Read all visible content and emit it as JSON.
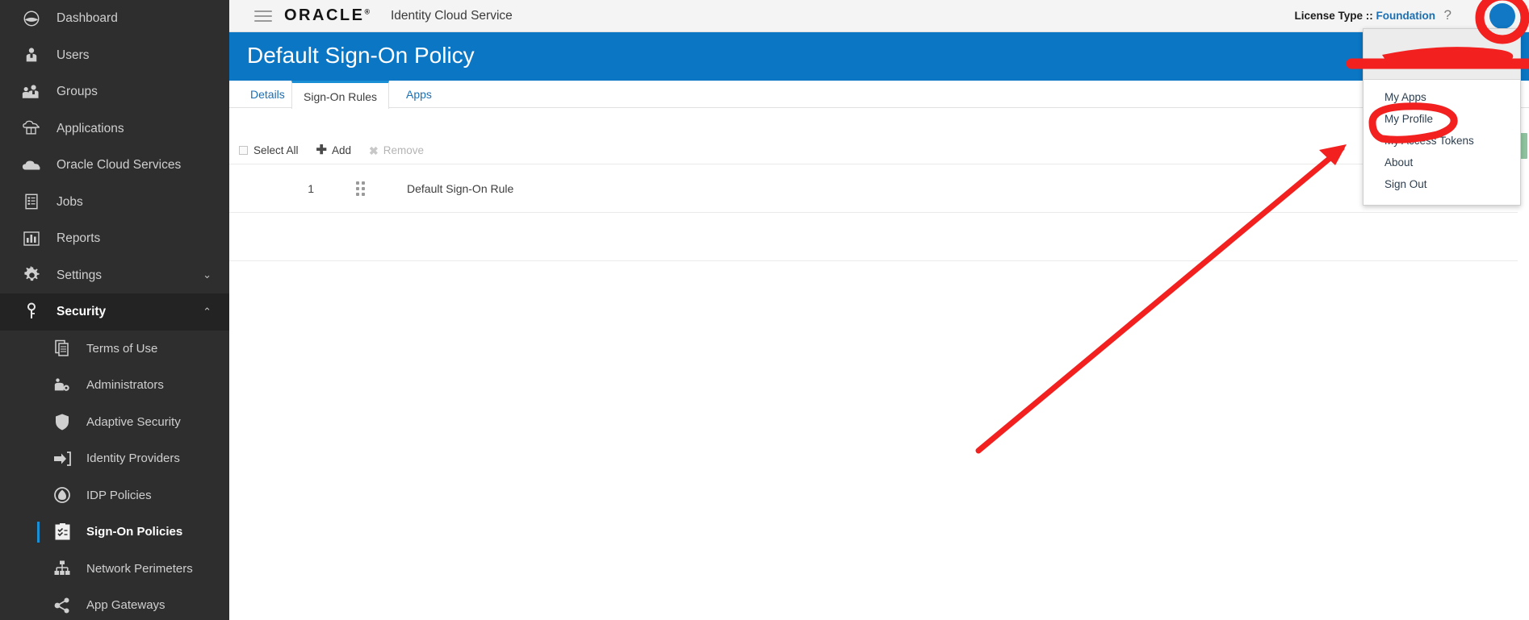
{
  "app": {
    "brand": "ORACLE",
    "brand_mark": "®",
    "name": "Identity Cloud Service",
    "hamburger_icon": "hamburger-menu-icon"
  },
  "topbar": {
    "license_label": "License Type ::",
    "license_value": "Foundation",
    "help_icon": "?",
    "avatar_icon": "user-avatar-icon",
    "avatar_color": "#1078c4"
  },
  "banner": {
    "title": "Default Sign-On Policy",
    "color": "#0a76c4"
  },
  "tabs": [
    {
      "label": "Details",
      "active": false
    },
    {
      "label": "Sign-On Rules",
      "active": true
    },
    {
      "label": "Apps",
      "active": false
    }
  ],
  "toolbar": {
    "select_all_label": "Select All",
    "add_label": "Add",
    "add_icon": "plus-icon",
    "remove_label": "Remove",
    "remove_icon": "close-x-icon",
    "remove_disabled": true
  },
  "table": {
    "rows": [
      {
        "number": "1",
        "handle_icon": "drag-handle-icon",
        "name": "Default Sign-On Rule"
      }
    ]
  },
  "scrollbar": {
    "thumb_color": "#8fc3a0"
  },
  "user_menu": {
    "username": "",
    "items": [
      {
        "label": "My Apps",
        "highlighted": false
      },
      {
        "label": "My Profile",
        "highlighted": true
      },
      {
        "label": "My Access Tokens",
        "highlighted": false
      },
      {
        "label": "About",
        "highlighted": false
      },
      {
        "label": "Sign Out",
        "highlighted": false
      }
    ]
  },
  "annotations": {
    "color": "#f32020",
    "shapes": [
      "circle-around-avatar",
      "redaction-scribble-over-username",
      "circle-around-my-profile",
      "arrow-pointing-to-my-profile"
    ]
  },
  "sidebar": {
    "background": "#2e2e2e",
    "items": [
      {
        "label": "Dashboard",
        "icon": "dashboard-icon",
        "level": 0,
        "chevron": "",
        "active": false
      },
      {
        "label": "Users",
        "icon": "user-icon",
        "level": 0,
        "chevron": "",
        "active": false
      },
      {
        "label": "Groups",
        "icon": "groups-icon",
        "level": 0,
        "chevron": "",
        "active": false
      },
      {
        "label": "Applications",
        "icon": "applications-icon",
        "level": 0,
        "chevron": "",
        "active": false
      },
      {
        "label": "Oracle Cloud Services",
        "icon": "cloud-icon",
        "level": 0,
        "chevron": "",
        "active": false
      },
      {
        "label": "Jobs",
        "icon": "jobs-clipboard-icon",
        "level": 0,
        "chevron": "",
        "active": false
      },
      {
        "label": "Reports",
        "icon": "reports-bar-chart-icon",
        "level": 0,
        "chevron": "",
        "active": false
      },
      {
        "label": "Settings",
        "icon": "gear-icon",
        "level": 0,
        "chevron": "chevron-down-icon",
        "active": false
      },
      {
        "label": "Security",
        "icon": "key-icon",
        "level": 0,
        "chevron": "chevron-up-icon",
        "active": false,
        "expanded": true
      },
      {
        "label": "Terms of Use",
        "icon": "documents-icon",
        "level": 1,
        "chevron": "",
        "active": false
      },
      {
        "label": "Administrators",
        "icon": "administrators-icon",
        "level": 1,
        "chevron": "",
        "active": false
      },
      {
        "label": "Adaptive Security",
        "icon": "shield-icon",
        "level": 1,
        "chevron": "",
        "active": false
      },
      {
        "label": "Identity Providers",
        "icon": "sign-in-arrow-icon",
        "level": 1,
        "chevron": "",
        "active": false
      },
      {
        "label": "IDP Policies",
        "icon": "idp-policies-icon",
        "level": 1,
        "chevron": "",
        "active": false
      },
      {
        "label": "Sign-On Policies",
        "icon": "sign-on-policies-icon",
        "level": 1,
        "chevron": "",
        "active": true
      },
      {
        "label": "Network Perimeters",
        "icon": "network-perimeters-icon",
        "level": 1,
        "chevron": "",
        "active": false
      },
      {
        "label": "App Gateways",
        "icon": "share-nodes-icon",
        "level": 1,
        "chevron": "",
        "active": false
      }
    ]
  }
}
